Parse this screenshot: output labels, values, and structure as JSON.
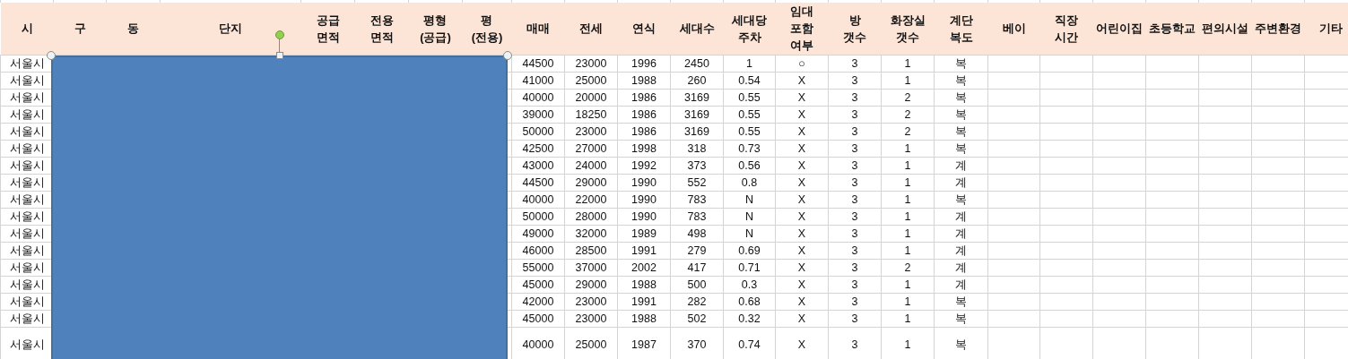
{
  "columns": [
    "시",
    "구",
    "동",
    "단지",
    "공급\n면적",
    "전용\n면적",
    "평형\n(공급)",
    "평\n(전용)",
    "매매",
    "전세",
    "연식",
    "세대수",
    "세대당\n주차",
    "임대\n포함\n여부",
    "방\n갯수",
    "화장실\n갯수",
    "계단\n복도",
    "베이",
    "직장\n시간",
    "어린이집",
    "초등학교",
    "편의시설",
    "주변환경",
    "기타"
  ],
  "rows": [
    {
      "city": "서울시",
      "values": [
        "44500",
        "23000",
        "1996",
        "2450",
        "1",
        "○",
        "3",
        "1",
        "복"
      ]
    },
    {
      "city": "서울시",
      "values": [
        "41000",
        "25000",
        "1988",
        "260",
        "0.54",
        "X",
        "3",
        "1",
        "복"
      ]
    },
    {
      "city": "서울시",
      "values": [
        "40000",
        "20000",
        "1986",
        "3169",
        "0.55",
        "X",
        "3",
        "2",
        "복"
      ]
    },
    {
      "city": "서울시",
      "values": [
        "39000",
        "18250",
        "1986",
        "3169",
        "0.55",
        "X",
        "3",
        "2",
        "복"
      ]
    },
    {
      "city": "서울시",
      "values": [
        "50000",
        "23000",
        "1986",
        "3169",
        "0.55",
        "X",
        "3",
        "2",
        "복"
      ]
    },
    {
      "city": "서울시",
      "values": [
        "42500",
        "27000",
        "1998",
        "318",
        "0.73",
        "X",
        "3",
        "1",
        "복"
      ]
    },
    {
      "city": "서울시",
      "values": [
        "43000",
        "24000",
        "1992",
        "373",
        "0.56",
        "X",
        "3",
        "1",
        "계"
      ]
    },
    {
      "city": "서울시",
      "values": [
        "44500",
        "29000",
        "1990",
        "552",
        "0.8",
        "X",
        "3",
        "1",
        "계"
      ]
    },
    {
      "city": "서울시",
      "values": [
        "40000",
        "22000",
        "1990",
        "783",
        "N",
        "X",
        "3",
        "1",
        "복"
      ]
    },
    {
      "city": "서울시",
      "values": [
        "50000",
        "28000",
        "1990",
        "783",
        "N",
        "X",
        "3",
        "1",
        "계"
      ]
    },
    {
      "city": "서울시",
      "values": [
        "49000",
        "32000",
        "1989",
        "498",
        "N",
        "X",
        "3",
        "1",
        "계"
      ]
    },
    {
      "city": "서울시",
      "values": [
        "46000",
        "28500",
        "1991",
        "279",
        "0.69",
        "X",
        "3",
        "1",
        "계"
      ]
    },
    {
      "city": "서울시",
      "values": [
        "55000",
        "37000",
        "2002",
        "417",
        "0.71",
        "X",
        "3",
        "2",
        "계"
      ]
    },
    {
      "city": "서울시",
      "values": [
        "45000",
        "29000",
        "1988",
        "500",
        "0.3",
        "X",
        "3",
        "1",
        "계"
      ]
    },
    {
      "city": "서울시",
      "values": [
        "42000",
        "23000",
        "1991",
        "282",
        "0.68",
        "X",
        "3",
        "1",
        "복"
      ]
    },
    {
      "city": "서울시",
      "values": [
        "45000",
        "23000",
        "1988",
        "502",
        "0.32",
        "X",
        "3",
        "1",
        "복"
      ]
    },
    {
      "city": "서울시",
      "values": [
        "40000",
        "25000",
        "1987",
        "370",
        "0.74",
        "X",
        "3",
        "1",
        "복"
      ]
    }
  ],
  "shape": {
    "kind": "rectangle",
    "selected": true
  }
}
